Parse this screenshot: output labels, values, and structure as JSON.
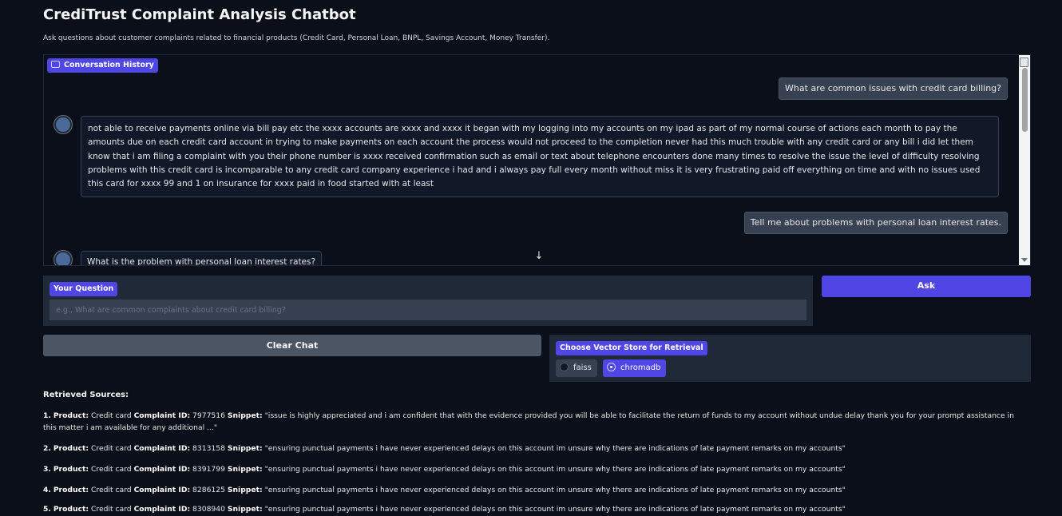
{
  "header": {
    "title": "CrediTrust Complaint Analysis Chatbot",
    "subtitle": "Ask questions about customer complaints related to financial products (Credit Card, Personal Loan, BNPL, Savings Account, Money Transfer)."
  },
  "chat": {
    "label": "Conversation History",
    "messages": [
      {
        "role": "user",
        "text": "What are common issues with credit card billing?"
      },
      {
        "role": "bot",
        "text": "not able to receive payments online via bill pay etc the xxxx accounts are xxxx and xxxx it began with my logging into my accounts on my ipad as part of my normal course of actions each month to pay the amounts due on each credit card account in trying to make payments on each account the process would not proceed to the completion never had this much trouble with any credit card or any bill i did let them know that i am filing a complaint with you their phone number is xxxx received confirmation such as email or text about telephone encounters done many times to resolve the issue the level of difficulty resolving problems with this credit card is incomparable to any credit card company experience i had and i always pay full every month without miss it is very frustrating paid off everything on time and with no issues used this card for xxxx 99 and 1 on insurance for xxxx paid in food started with at least"
      },
      {
        "role": "user",
        "text": "Tell me about problems with personal loan interest rates."
      },
      {
        "role": "bot",
        "text": "What is the problem with personal loan interest rates?"
      }
    ]
  },
  "question": {
    "label": "Your Question",
    "placeholder": "e.g., What are common complaints about credit card billing?"
  },
  "buttons": {
    "ask": "Ask",
    "clear": "Clear Chat"
  },
  "vector_store": {
    "label": "Choose Vector Store for Retrieval",
    "options": [
      "faiss",
      "chromadb"
    ],
    "selected": "chromadb"
  },
  "sources": {
    "title": "Retrieved Sources:",
    "product_label": "Product:",
    "complaint_label": "Complaint ID:",
    "snippet_label": "Snippet:",
    "items": [
      {
        "num": "1.",
        "product": "Credit card",
        "complaint_id": "7977516",
        "snippet": "\"issue is highly appreciated and i am confident that with the evidence provided you will be able to facilitate the return of funds to my account without undue delay thank you for your prompt assistance in this matter i am available for any additional ...\""
      },
      {
        "num": "2.",
        "product": "Credit card",
        "complaint_id": "8313158",
        "snippet": "\"ensuring punctual payments i have never experienced delays on this account im unsure why there are indications of late payment remarks on my accounts\""
      },
      {
        "num": "3.",
        "product": "Credit card",
        "complaint_id": "8391799",
        "snippet": "\"ensuring punctual payments i have never experienced delays on this account im unsure why there are indications of late payment remarks on my accounts\""
      },
      {
        "num": "4.",
        "product": "Credit card",
        "complaint_id": "8286125",
        "snippet": "\"ensuring punctual payments i have never experienced delays on this account im unsure why there are indications of late payment remarks on my accounts\""
      },
      {
        "num": "5.",
        "product": "Credit card",
        "complaint_id": "8308940",
        "snippet": "\"ensuring punctual payments i have never experienced delays on this account im unsure why there are indications of late payment remarks on my accounts\""
      }
    ]
  },
  "colors": {
    "background": "#0b0f19",
    "accent": "#4f46e5",
    "panel": "#1f2937"
  }
}
